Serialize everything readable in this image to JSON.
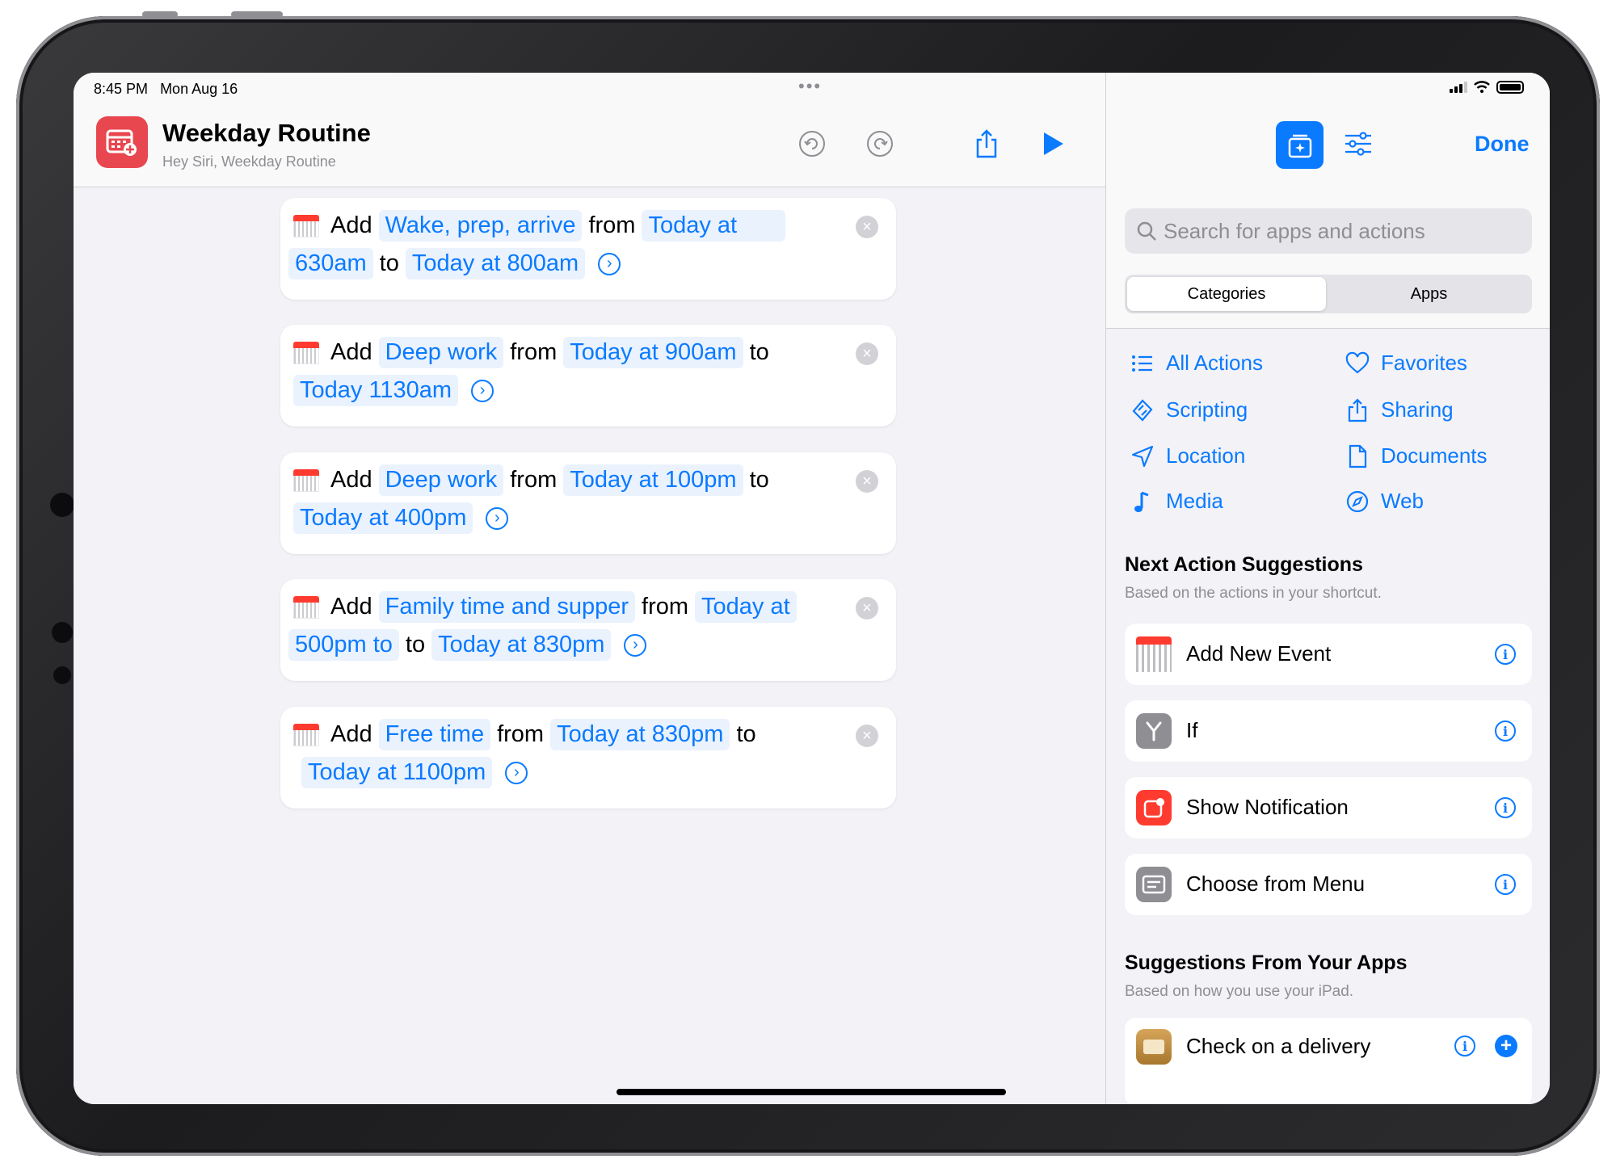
{
  "status": {
    "time": "8:45 PM",
    "date": "Mon Aug 16",
    "dots": "•••"
  },
  "shortcut": {
    "title": "Weekday Routine",
    "subtitle": "Hey Siri, Weekday Routine"
  },
  "actions": [
    {
      "verb": "Add",
      "event": "Wake, prep, arrive",
      "from": "from",
      "start1": "Today at",
      "start2": "630am",
      "to": "to",
      "end": "Today at 800am"
    },
    {
      "verb": "Add",
      "event": "Deep work",
      "from": "from",
      "start": "Today at 900am",
      "to": "to",
      "end": "Today 1130am"
    },
    {
      "verb": "Add",
      "event": "Deep work",
      "from": "from",
      "start": "Today at 100pm",
      "to": "to",
      "end": "Today at 400pm"
    },
    {
      "verb": "Add",
      "event": "Family time and supper",
      "from": "from",
      "start1": "Today at",
      "start2": "500pm to",
      "to": "to",
      "end": "Today at 830pm"
    },
    {
      "verb": "Add",
      "event": "Free time",
      "from": "from",
      "start": "Today at 830pm",
      "to": "to",
      "end": "Today at 1100pm"
    }
  ],
  "panel": {
    "done_label": "Done",
    "search_placeholder": "Search for apps and actions",
    "segments": [
      "Categories",
      "Apps"
    ],
    "categories": [
      {
        "label": "All Actions",
        "icon": "list-icon"
      },
      {
        "label": "Favorites",
        "icon": "heart-icon"
      },
      {
        "label": "Scripting",
        "icon": "scripting-icon"
      },
      {
        "label": "Sharing",
        "icon": "share-icon"
      },
      {
        "label": "Location",
        "icon": "location-arrow-icon"
      },
      {
        "label": "Documents",
        "icon": "document-icon"
      },
      {
        "label": "Media",
        "icon": "music-note-icon"
      },
      {
        "label": "Web",
        "icon": "compass-icon"
      }
    ],
    "next_title": "Next Action Suggestions",
    "next_sub": "Based on the actions in your shortcut.",
    "next_items": [
      {
        "label": "Add New Event",
        "icon": "calendar-icon"
      },
      {
        "label": "If",
        "icon": "if-branch-icon"
      },
      {
        "label": "Show Notification",
        "icon": "notification-icon"
      },
      {
        "label": "Choose from Menu",
        "icon": "menu-icon"
      }
    ],
    "apps_title": "Suggestions From Your Apps",
    "apps_sub": "Based on how you use your iPad.",
    "apps_items": [
      {
        "label": "Check on a delivery",
        "icon": "delivery-box-icon"
      }
    ]
  },
  "colors": {
    "accent": "#0a7aff",
    "calendar_red": "#ff3b30",
    "app_icon": "#e8474f"
  }
}
